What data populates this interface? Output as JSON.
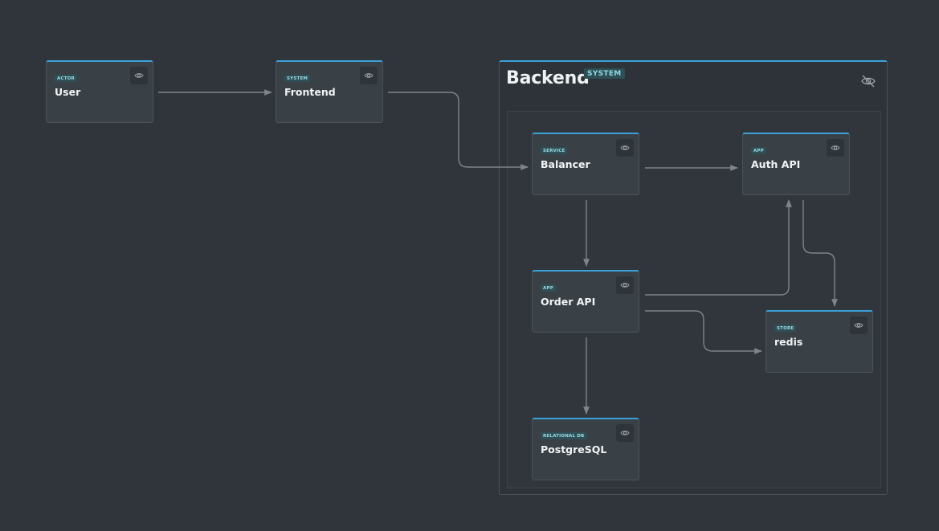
{
  "group": {
    "title": "Backend",
    "badge": "SYSTEM"
  },
  "nodes": [
    {
      "id": "user",
      "badge": "ACTOR",
      "label": "User"
    },
    {
      "id": "frontend",
      "badge": "SYSTEM",
      "label": "Frontend"
    },
    {
      "id": "balancer",
      "badge": "SERVICE",
      "label": "Balancer"
    },
    {
      "id": "auth-api",
      "badge": "APP",
      "label": "Auth API"
    },
    {
      "id": "order-api",
      "badge": "APP",
      "label": "Order API"
    },
    {
      "id": "redis",
      "badge": "STORE",
      "label": "redis"
    },
    {
      "id": "postgresql",
      "badge": "RELATIONAL DB",
      "label": "PostgreSQL"
    }
  ],
  "edges": [
    {
      "from": "User",
      "to": "Frontend"
    },
    {
      "from": "Frontend",
      "to": "Balancer"
    },
    {
      "from": "Balancer",
      "to": "Auth API"
    },
    {
      "from": "Balancer",
      "to": "Order API"
    },
    {
      "from": "Auth API",
      "to": "redis"
    },
    {
      "from": "Order API",
      "to": "Auth API"
    },
    {
      "from": "Order API",
      "to": "redis"
    },
    {
      "from": "Order API",
      "to": "PostgreSQL"
    }
  ],
  "icons": {
    "node_toggle": "eye-icon",
    "group_toggle": "eye-off-icon"
  },
  "colors": {
    "background": "#2f353b",
    "node_fill": "#3a4146",
    "accent": "#3aa1d8",
    "badge_text": "#9fdbe6",
    "edge": "#7d848a"
  }
}
